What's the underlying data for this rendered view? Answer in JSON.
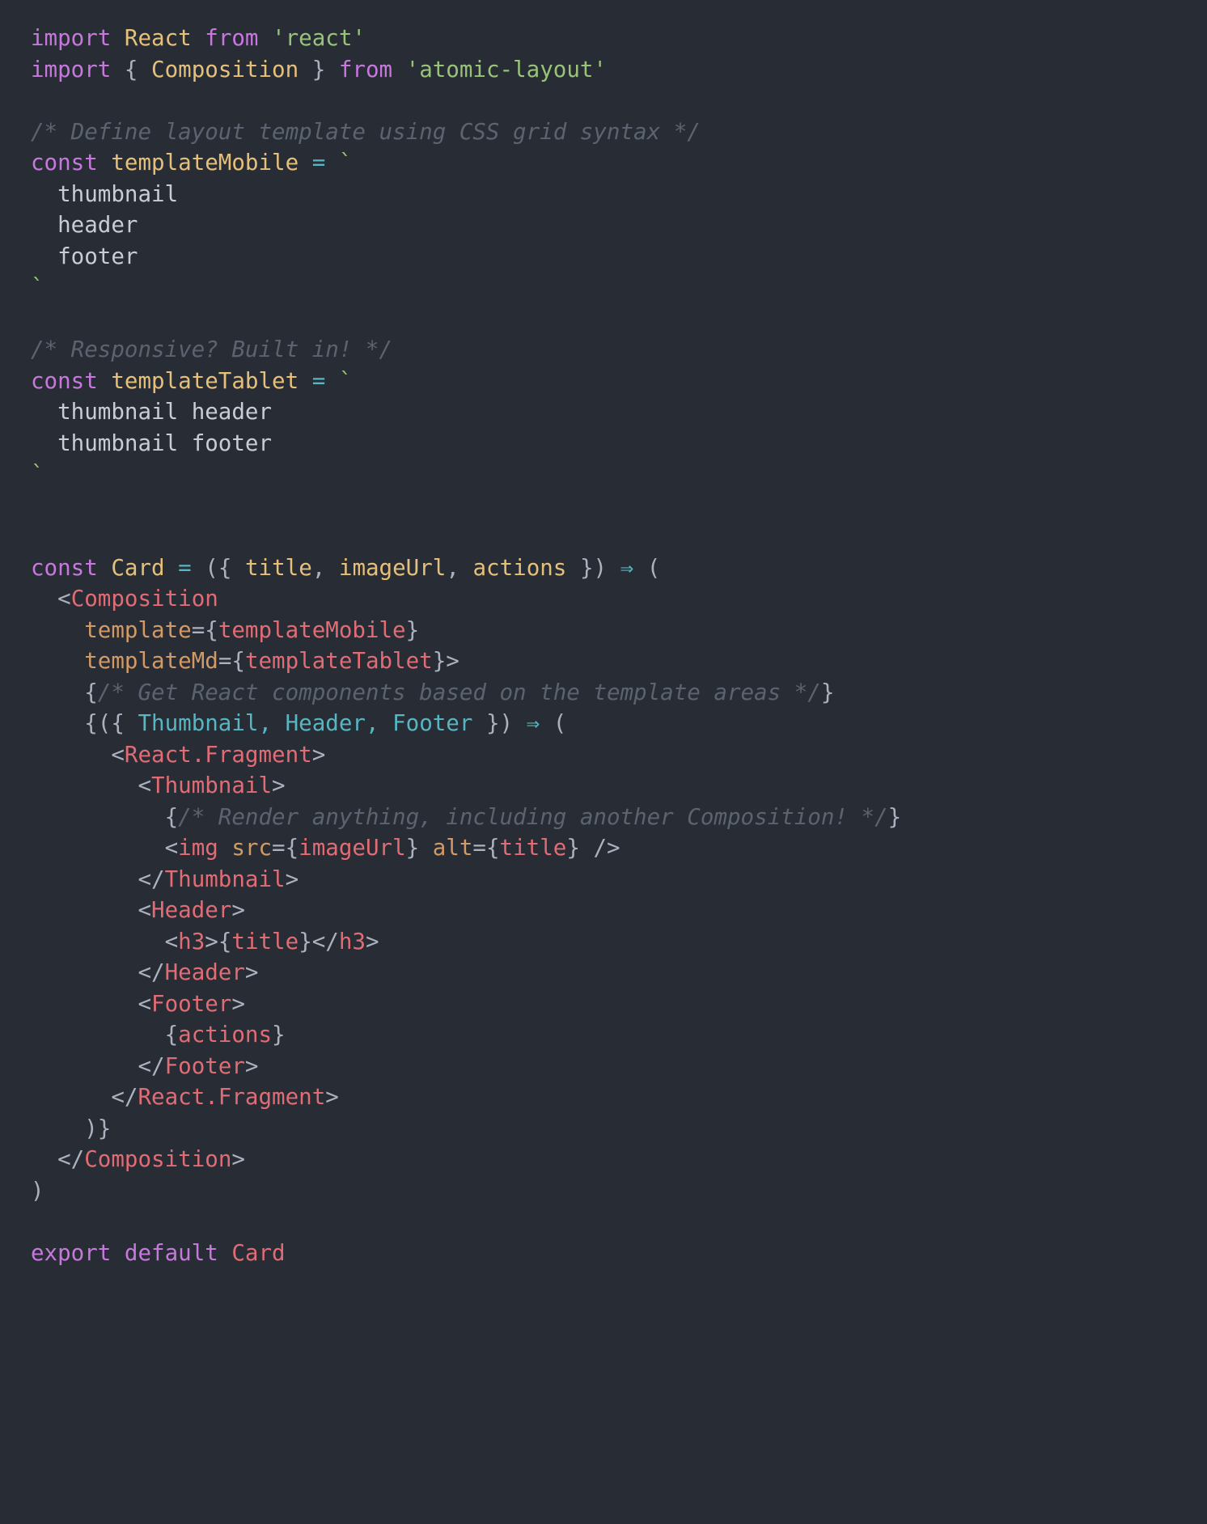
{
  "editor": {
    "language": "jsx",
    "background_color": "#282c34",
    "default_text_color": "#abb2bf",
    "font_size_px": 27.5,
    "line_height_px": 38.5
  },
  "palette": {
    "keyword": "#c678dd",
    "identifier": "#e5c07b",
    "string": "#98c379",
    "comment": "#5c6370",
    "operator": "#56b6c2",
    "punctuation": "#abb2bf",
    "template_literal": "#c8ccd4",
    "jsx_tag": "#e06c75",
    "jsx_attribute": "#d19a66",
    "jsx_value": "#e06c75"
  },
  "code": {
    "lines": [
      {
        "n": 1,
        "text": "import React from 'react'"
      },
      {
        "n": 2,
        "text": "import { Composition } from 'atomic-layout'"
      },
      {
        "n": 3,
        "text": ""
      },
      {
        "n": 4,
        "text": "/* Define layout template using CSS grid syntax */"
      },
      {
        "n": 5,
        "text": "const templateMobile = `"
      },
      {
        "n": 6,
        "text": "  thumbnail"
      },
      {
        "n": 7,
        "text": "  header"
      },
      {
        "n": 8,
        "text": "  footer"
      },
      {
        "n": 9,
        "text": "`"
      },
      {
        "n": 10,
        "text": ""
      },
      {
        "n": 11,
        "text": "/* Responsive? Built in! */"
      },
      {
        "n": 12,
        "text": "const templateTablet = `"
      },
      {
        "n": 13,
        "text": "  thumbnail header"
      },
      {
        "n": 14,
        "text": "  thumbnail footer"
      },
      {
        "n": 15,
        "text": "`"
      },
      {
        "n": 16,
        "text": ""
      },
      {
        "n": 17,
        "text": ""
      },
      {
        "n": 18,
        "text": "const Card = ({ title, imageUrl, actions }) => ("
      },
      {
        "n": 19,
        "text": "  <Composition"
      },
      {
        "n": 20,
        "text": "    template={templateMobile}"
      },
      {
        "n": 21,
        "text": "    templateMd={templateTablet}>"
      },
      {
        "n": 22,
        "text": "    {/* Get React components based on the template areas */}"
      },
      {
        "n": 23,
        "text": "    {({ Thumbnail, Header, Footer }) => ("
      },
      {
        "n": 24,
        "text": "      <React.Fragment>"
      },
      {
        "n": 25,
        "text": "        <Thumbnail>"
      },
      {
        "n": 26,
        "text": "          {/* Render anything, including another Composition! */}"
      },
      {
        "n": 27,
        "text": "          <img src={imageUrl} alt={title} />"
      },
      {
        "n": 28,
        "text": "        </Thumbnail>"
      },
      {
        "n": 29,
        "text": "        <Header>"
      },
      {
        "n": 30,
        "text": "          <h3>{title}</h3>"
      },
      {
        "n": 31,
        "text": "        </Header>"
      },
      {
        "n": 32,
        "text": "        <Footer>"
      },
      {
        "n": 33,
        "text": "          {actions}"
      },
      {
        "n": 34,
        "text": "        </Footer>"
      },
      {
        "n": 35,
        "text": "      </React.Fragment>"
      },
      {
        "n": 36,
        "text": "    )}"
      },
      {
        "n": 37,
        "text": "  </Composition>"
      },
      {
        "n": 38,
        "text": ")"
      },
      {
        "n": 39,
        "text": ""
      },
      {
        "n": 40,
        "text": "export default Card"
      }
    ],
    "imports": [
      {
        "default_binding": "React",
        "module": "'react'"
      },
      {
        "named_bindings": "{ Composition }",
        "module": "'atomic-layout'"
      }
    ],
    "comments": [
      "/* Define layout template using CSS grid syntax */",
      "/* Responsive? Built in! */",
      "{/* Get React components based on the template areas */}",
      "{/* Render anything, including another Composition! */}"
    ],
    "constants": [
      {
        "name": "templateMobile",
        "areas": [
          "thumbnail",
          "header",
          "footer"
        ]
      },
      {
        "name": "templateTablet",
        "areas": [
          "thumbnail header",
          "thumbnail footer"
        ]
      }
    ],
    "component": {
      "name": "Card",
      "props": [
        "title",
        "imageUrl",
        "actions"
      ],
      "render_props": [
        "Thumbnail",
        "Header",
        "Footer"
      ],
      "jsx_attributes": [
        {
          "name": "template",
          "value": "{templateMobile}"
        },
        {
          "name": "templateMd",
          "value": "{templateTablet}"
        },
        {
          "name": "src",
          "value": "{imageUrl}"
        },
        {
          "name": "alt",
          "value": "{title}"
        }
      ]
    },
    "export_statement": "export default Card"
  },
  "tokens": {
    "kw_import": "import",
    "kw_from": "from",
    "kw_const": "const",
    "kw_export": "export",
    "kw_default": "default",
    "arrow": "⇒",
    "backtick": "`",
    "react": "React",
    "composition": "Composition",
    "mod_react": "'react'",
    "mod_atomic": "'atomic-layout'",
    "template_mobile": "templateMobile",
    "template_tablet": "templateTablet",
    "card": "Card",
    "title": "title",
    "image_url": "imageUrl",
    "actions": "actions",
    "thumbnail": "Thumbnail",
    "header": "Header",
    "footer": "Footer",
    "img": "img",
    "h3": "h3",
    "react_fragment": "React.Fragment",
    "attr_template": "template",
    "attr_template_md": "templateMd",
    "attr_src": "src",
    "attr_alt": "alt",
    "area_thumbnail": "thumbnail",
    "area_header": "header",
    "area_footer": "footer",
    "area_thumb_header": "thumbnail header",
    "area_thumb_footer": "thumbnail footer",
    "comment_define": "/* Define layout template using CSS grid syntax */",
    "comment_responsive": "/* Responsive? Built in! */",
    "comment_get_components": "/* Get React components based on the template areas */",
    "comment_render_anything": "/* Render anything, including another Composition! */"
  }
}
